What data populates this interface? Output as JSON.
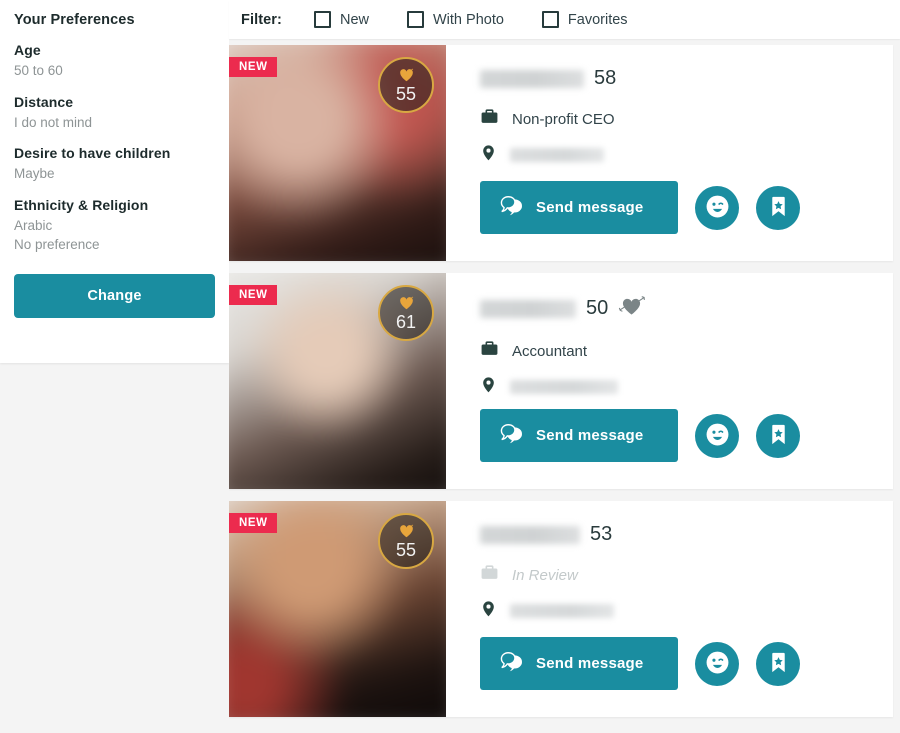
{
  "theme": {
    "accent": "#1a8da0",
    "badge_new": "#ec2b4e",
    "match_ring": "#d8a842",
    "text_dark": "#1d2b2c",
    "text_muted": "#8e9495"
  },
  "sidebar": {
    "title": "Your Preferences",
    "groups": [
      {
        "label": "Age",
        "values": [
          "50 to 60"
        ]
      },
      {
        "label": "Distance",
        "values": [
          "I do not mind"
        ]
      },
      {
        "label": "Desire to have children",
        "values": [
          "Maybe"
        ]
      },
      {
        "label": "Ethnicity & Religion",
        "values": [
          "Arabic",
          "No preference"
        ]
      }
    ],
    "change_label": "Change"
  },
  "filter": {
    "label": "Filter:",
    "options": [
      {
        "label": "New",
        "checked": false
      },
      {
        "label": "With Photo",
        "checked": false
      },
      {
        "label": "Favorites",
        "checked": false
      }
    ]
  },
  "cards": [
    {
      "new_badge": "NEW",
      "match_score": "55",
      "match_icon": "heart-icon",
      "name": "",
      "name_redacted": true,
      "age": "58",
      "has_cupid_icon": false,
      "occupation": "Non-profit CEO",
      "occupation_in_review": false,
      "location": "",
      "location_redacted": true,
      "send_label": "Send message",
      "wink_icon": "smiley-wink-icon",
      "favorite_icon": "bookmark-star-icon"
    },
    {
      "new_badge": "NEW",
      "match_score": "61",
      "match_icon": "heart-icon",
      "name": "",
      "name_redacted": true,
      "age": "50",
      "has_cupid_icon": true,
      "occupation": "Accountant",
      "occupation_in_review": false,
      "location": "",
      "location_redacted": true,
      "send_label": "Send message",
      "wink_icon": "smiley-wink-icon",
      "favorite_icon": "bookmark-star-icon"
    },
    {
      "new_badge": "NEW",
      "match_score": "55",
      "match_icon": "heart-icon",
      "name": "",
      "name_redacted": true,
      "age": "53",
      "has_cupid_icon": false,
      "occupation": "In Review",
      "occupation_in_review": true,
      "location": "",
      "location_redacted": true,
      "send_label": "Send message",
      "wink_icon": "smiley-wink-icon",
      "favorite_icon": "bookmark-star-icon"
    }
  ]
}
